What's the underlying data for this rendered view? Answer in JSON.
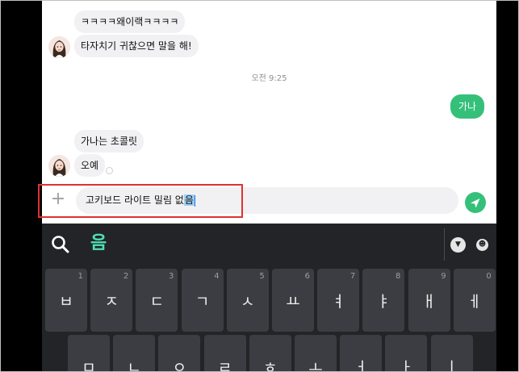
{
  "chat": {
    "messages": [
      {
        "text": "ㅋㅋㅋㅋ왜이랙ㅋㅋㅋㅋ"
      },
      {
        "text": "타자치기 귀찮으면 말을 해!"
      }
    ],
    "time_separator": "오전 9:25",
    "my_message": "가나",
    "messages2": [
      {
        "text": "가나는 초콜릿"
      },
      {
        "text": "오예"
      }
    ]
  },
  "input": {
    "typed_text": "고키보드 라이트 밀림 없",
    "composing_text": "음"
  },
  "keyboard": {
    "suggestion": "음",
    "row1": [
      {
        "label": "ㅂ",
        "num": "1"
      },
      {
        "label": "ㅈ",
        "num": "2"
      },
      {
        "label": "ㄷ",
        "num": "3"
      },
      {
        "label": "ㄱ",
        "num": "4"
      },
      {
        "label": "ㅅ",
        "num": "5"
      },
      {
        "label": "ㅛ",
        "num": "6"
      },
      {
        "label": "ㅕ",
        "num": "7"
      },
      {
        "label": "ㅑ",
        "num": "8"
      },
      {
        "label": "ㅐ",
        "num": "9"
      },
      {
        "label": "ㅔ",
        "num": "0"
      }
    ],
    "row2": [
      {
        "label": "ㅁ"
      },
      {
        "label": "ㄴ"
      },
      {
        "label": "ㅇ"
      },
      {
        "label": "ㄹ"
      },
      {
        "label": "ㅎ"
      },
      {
        "label": "ㅗ"
      },
      {
        "label": "ㅓ"
      },
      {
        "label": "ㅏ"
      },
      {
        "label": "ㅣ"
      }
    ]
  },
  "colors": {
    "accent_green": "#35c07a",
    "suggestion_teal": "#4fe0b4",
    "highlight_red": "#e0312f",
    "keyboard_bg": "#232427",
    "key_bg": "#3b3d42"
  },
  "icons": {
    "plus": "plus-icon",
    "send": "send-icon",
    "search": "search-icon",
    "collapse": "chevron-down-icon",
    "emoji": "emoji-icon"
  }
}
